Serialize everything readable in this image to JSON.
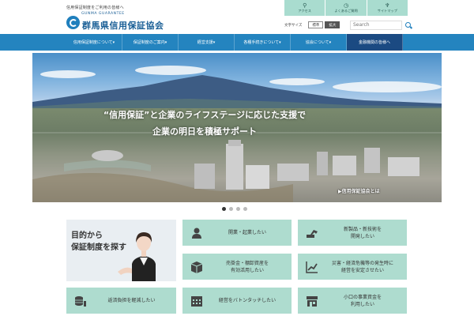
{
  "header": {
    "tagline": "信用保証制度をご利用の皆様へ",
    "logo_en": "GUNMA GUARANTEE",
    "logo_jp": "群馬県信用保証協会"
  },
  "util_nav": [
    {
      "icon": "map-pin-icon",
      "glyph": "⚲",
      "label": "アクセス"
    },
    {
      "icon": "clock-icon",
      "glyph": "◷",
      "label": "よくあるご質問"
    },
    {
      "icon": "sitemap-icon",
      "glyph": "♆",
      "label": "サイトマップ"
    }
  ],
  "text_size": {
    "label": "文字サイズ",
    "small": "標準",
    "large": "拡大"
  },
  "search": {
    "placeholder": "Search"
  },
  "main_nav": [
    "信用保証制度について▾",
    "保証制度のご案内▾",
    "経営支援▾",
    "各種手続きについて▾",
    "協会について▾",
    "金融機関の皆様へ"
  ],
  "hero": {
    "line1": "“信用保証”と企業のライフステージに応じた支援で",
    "line2": "企業の明日を積極サポート",
    "link": "▶信用保証協会とは"
  },
  "promo": {
    "line1": "目的から",
    "line2": "保証制度を探す"
  },
  "tiles": [
    {
      "icon": "person-icon",
      "label1": "開業・起業したい",
      "label2": ""
    },
    {
      "icon": "excavator-icon",
      "label1": "新製品・新技術を",
      "label2": "開発したい"
    },
    {
      "icon": "box-icon",
      "label1": "売掛金・棚卸資産を",
      "label2": "有効活用したい"
    },
    {
      "icon": "chart-up-icon",
      "label1": "災害・経済危機等の発生時に",
      "label2": "経営を安定させたい"
    },
    {
      "icon": "coins-icon",
      "label1": "返済負担を軽減したい",
      "label2": ""
    },
    {
      "icon": "calendar-icon",
      "label1": "経営をバトンタッチしたい",
      "label2": ""
    },
    {
      "icon": "shop-icon",
      "label1": "小口の事業資金を",
      "label2": "利用したい"
    }
  ],
  "colors": {
    "nav_blue": "#2484bf",
    "nav_highlight": "#1b4a82",
    "tile_mint": "#aedccf",
    "icon_dark": "#444444"
  }
}
